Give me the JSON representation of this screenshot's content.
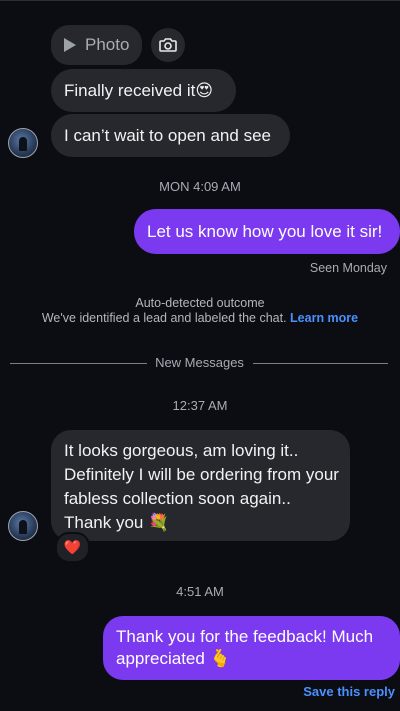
{
  "thread": {
    "photo_label": "Photo",
    "msg_finally": "Finally received it😍",
    "msg_cant_wait": "I can’t wait to open and see",
    "time_1": "MON 4:09 AM",
    "msg_outgoing_1": "Let us know how you love it sir!",
    "seen_label": "Seen Monday",
    "auto_title": "Auto-detected outcome",
    "auto_body": "We've identified a lead and labeled the chat.",
    "learn_more": "Learn more",
    "divider_label": "New Messages",
    "time_2": "12:37 AM",
    "msg_gorgeous": "It looks gorgeous, am loving it.. Definitely I will be ordering from your fabless collection soon again.. Thank you 💐",
    "reaction": "❤️",
    "time_3": "4:51 AM",
    "msg_outgoing_2": "Thank you for the feedback! Much appreciated 🫰",
    "save_reply": "Save this reply"
  },
  "colors": {
    "background": "#0b0d12",
    "incoming_bubble": "#26282d",
    "outgoing_bubble": "#7b39f0",
    "link_blue": "#4a90ff"
  }
}
